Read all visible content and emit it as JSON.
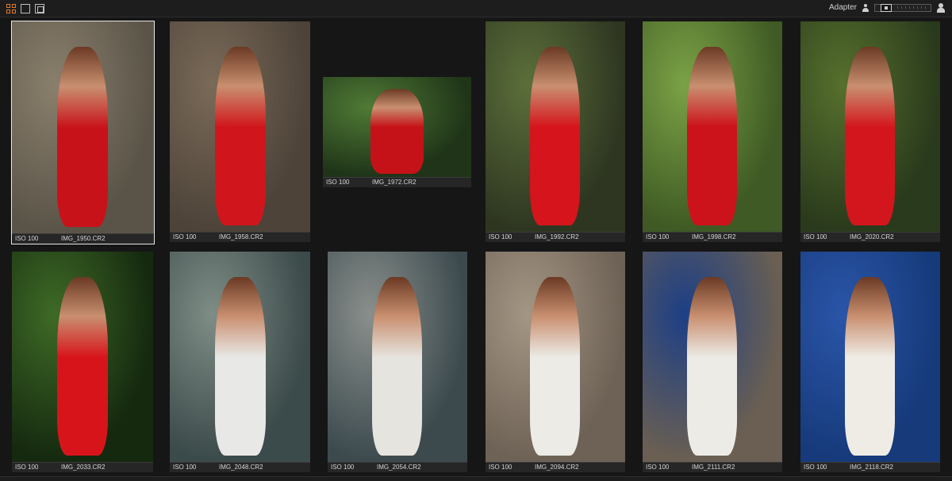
{
  "toolbar": {
    "adapter_label": "Adapter",
    "view_modes": [
      "grid-view-icon",
      "single-view-icon",
      "compare-view-icon"
    ],
    "accent_color": "#e07a2a"
  },
  "thumbnails": [
    {
      "iso": "ISO 100",
      "file": "IMG_1950.CR2",
      "selected": true,
      "palette": [
        "#5a5448",
        "#8a7f6c",
        "#c8121a"
      ]
    },
    {
      "iso": "ISO 100",
      "file": "IMG_1958.CR2",
      "selected": false,
      "palette": [
        "#4d4339",
        "#7a6a58",
        "#d0161c"
      ]
    },
    {
      "iso": "ISO 100",
      "file": "IMG_1972.CR2",
      "selected": false,
      "palette": [
        "#1f3418",
        "#4f7a35",
        "#c51218"
      ]
    },
    {
      "iso": "ISO 100",
      "file": "IMG_1992.CR2",
      "selected": false,
      "palette": [
        "#2e3621",
        "#5c6f3a",
        "#d5141c"
      ]
    },
    {
      "iso": "ISO 100",
      "file": "IMG_1998.CR2",
      "selected": false,
      "palette": [
        "#3f5a24",
        "#7ba246",
        "#cc121a"
      ]
    },
    {
      "iso": "ISO 100",
      "file": "IMG_2020.CR2",
      "selected": false,
      "palette": [
        "#2a3a1c",
        "#56702d",
        "#d3161d"
      ]
    },
    {
      "iso": "ISO 100",
      "file": "IMG_2033.CR2",
      "selected": false,
      "palette": [
        "#15290f",
        "#3e6a26",
        "#d8141b"
      ]
    },
    {
      "iso": "ISO 100",
      "file": "IMG_2048.CR2",
      "selected": false,
      "palette": [
        "#3b4a4a",
        "#7f8d86",
        "#e8e8e6"
      ]
    },
    {
      "iso": "ISO 100",
      "file": "IMG_2054.CR2",
      "selected": false,
      "palette": [
        "#3c4a4e",
        "#8a8f8c",
        "#e6e4de"
      ]
    },
    {
      "iso": "ISO 100",
      "file": "IMG_2094.CR2",
      "selected": false,
      "palette": [
        "#6e6256",
        "#a49684",
        "#ecebe6"
      ]
    },
    {
      "iso": "ISO 100",
      "file": "IMG_2111.CR2",
      "selected": false,
      "palette": [
        "#6a5f52",
        "#1d3f86",
        "#ecebe6"
      ]
    },
    {
      "iso": "ISO 100",
      "file": "IMG_2118.CR2",
      "selected": false,
      "palette": [
        "#163a7a",
        "#2a55a8",
        "#efece6"
      ]
    }
  ]
}
